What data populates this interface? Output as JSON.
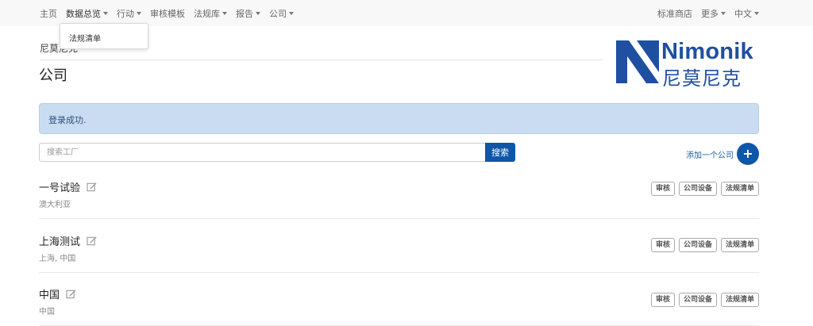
{
  "nav": {
    "left": [
      {
        "label": "主页",
        "caret": false
      },
      {
        "label": "数据总览",
        "caret": true
      },
      {
        "label": "行动",
        "caret": true
      },
      {
        "label": "审核模板",
        "caret": false
      },
      {
        "label": "法规库",
        "caret": true
      },
      {
        "label": "报告",
        "caret": true
      },
      {
        "label": "公司",
        "caret": true
      }
    ],
    "right": [
      {
        "label": "标准商店",
        "caret": false
      },
      {
        "label": "更多",
        "caret": true
      },
      {
        "label": "中文",
        "caret": true
      }
    ]
  },
  "dropdown": {
    "item": "法规清单"
  },
  "header": {
    "breadcrumb": "尼莫尼克",
    "title": "公司"
  },
  "logo": {
    "en": "Nimonik",
    "cn": "尼莫尼克",
    "color": "#1f4fa0"
  },
  "alert": {
    "message": "登录成功."
  },
  "search": {
    "placeholder": "搜索工厂",
    "value": "",
    "button": "搜索"
  },
  "add": {
    "label": "添加一个公司",
    "icon": "plus-icon",
    "symbol": "+"
  },
  "companies": [
    {
      "name": "一号试验",
      "location": "澳大利亚",
      "actions": [
        "审核",
        "公司设备",
        "法规清单"
      ]
    },
    {
      "name": "上海测试",
      "location": "上海, 中国",
      "actions": [
        "审核",
        "公司设备",
        "法规清单"
      ]
    },
    {
      "name": "中国",
      "location": "中国",
      "actions": [
        "审核",
        "公司设备",
        "法规清单"
      ]
    }
  ],
  "colors": {
    "primary": "#0d56a8",
    "alert_bg": "#cadcf1",
    "nav_bg": "#f8f8f8"
  }
}
